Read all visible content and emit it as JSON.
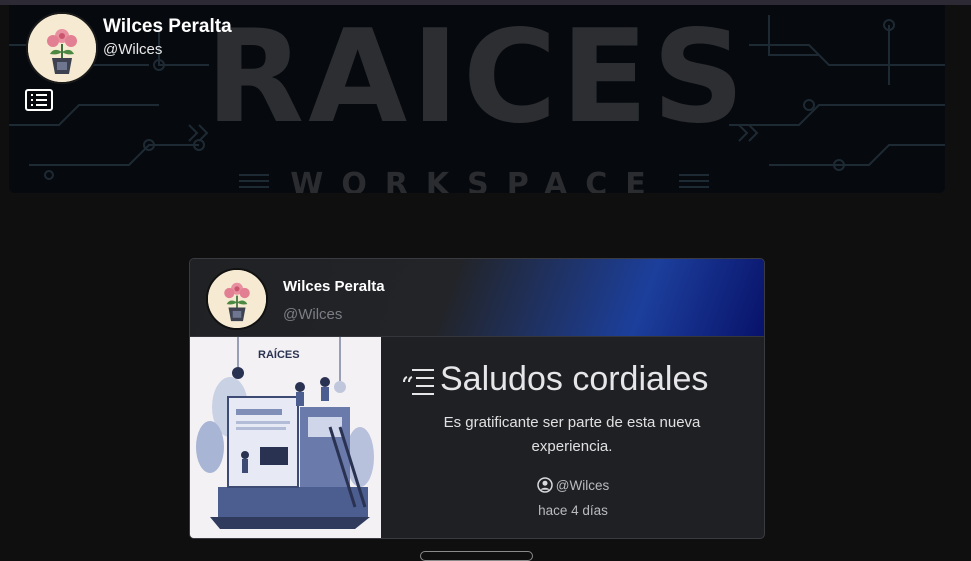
{
  "profile": {
    "name": "Wilces Peralta",
    "handle": "@Wilces"
  },
  "banner": {
    "title": "RAICES",
    "subtitle": "WORKSPACE"
  },
  "post": {
    "author_name": "Wilces Peralta",
    "author_handle": "@Wilces",
    "title": "Saludos cordiales",
    "text": "Es gratificante ser parte de esta nueva experiencia.",
    "byline": "@Wilces",
    "time": "hace 4 días",
    "image_caption": "RAÍCES"
  },
  "icons": {
    "menu": "list-icon",
    "title": "quote-text-icon",
    "author": "user-circle-icon"
  },
  "colors": {
    "background": "#0f0f10",
    "card": "#1f2023",
    "accent_blue": "#1c3f9c"
  }
}
